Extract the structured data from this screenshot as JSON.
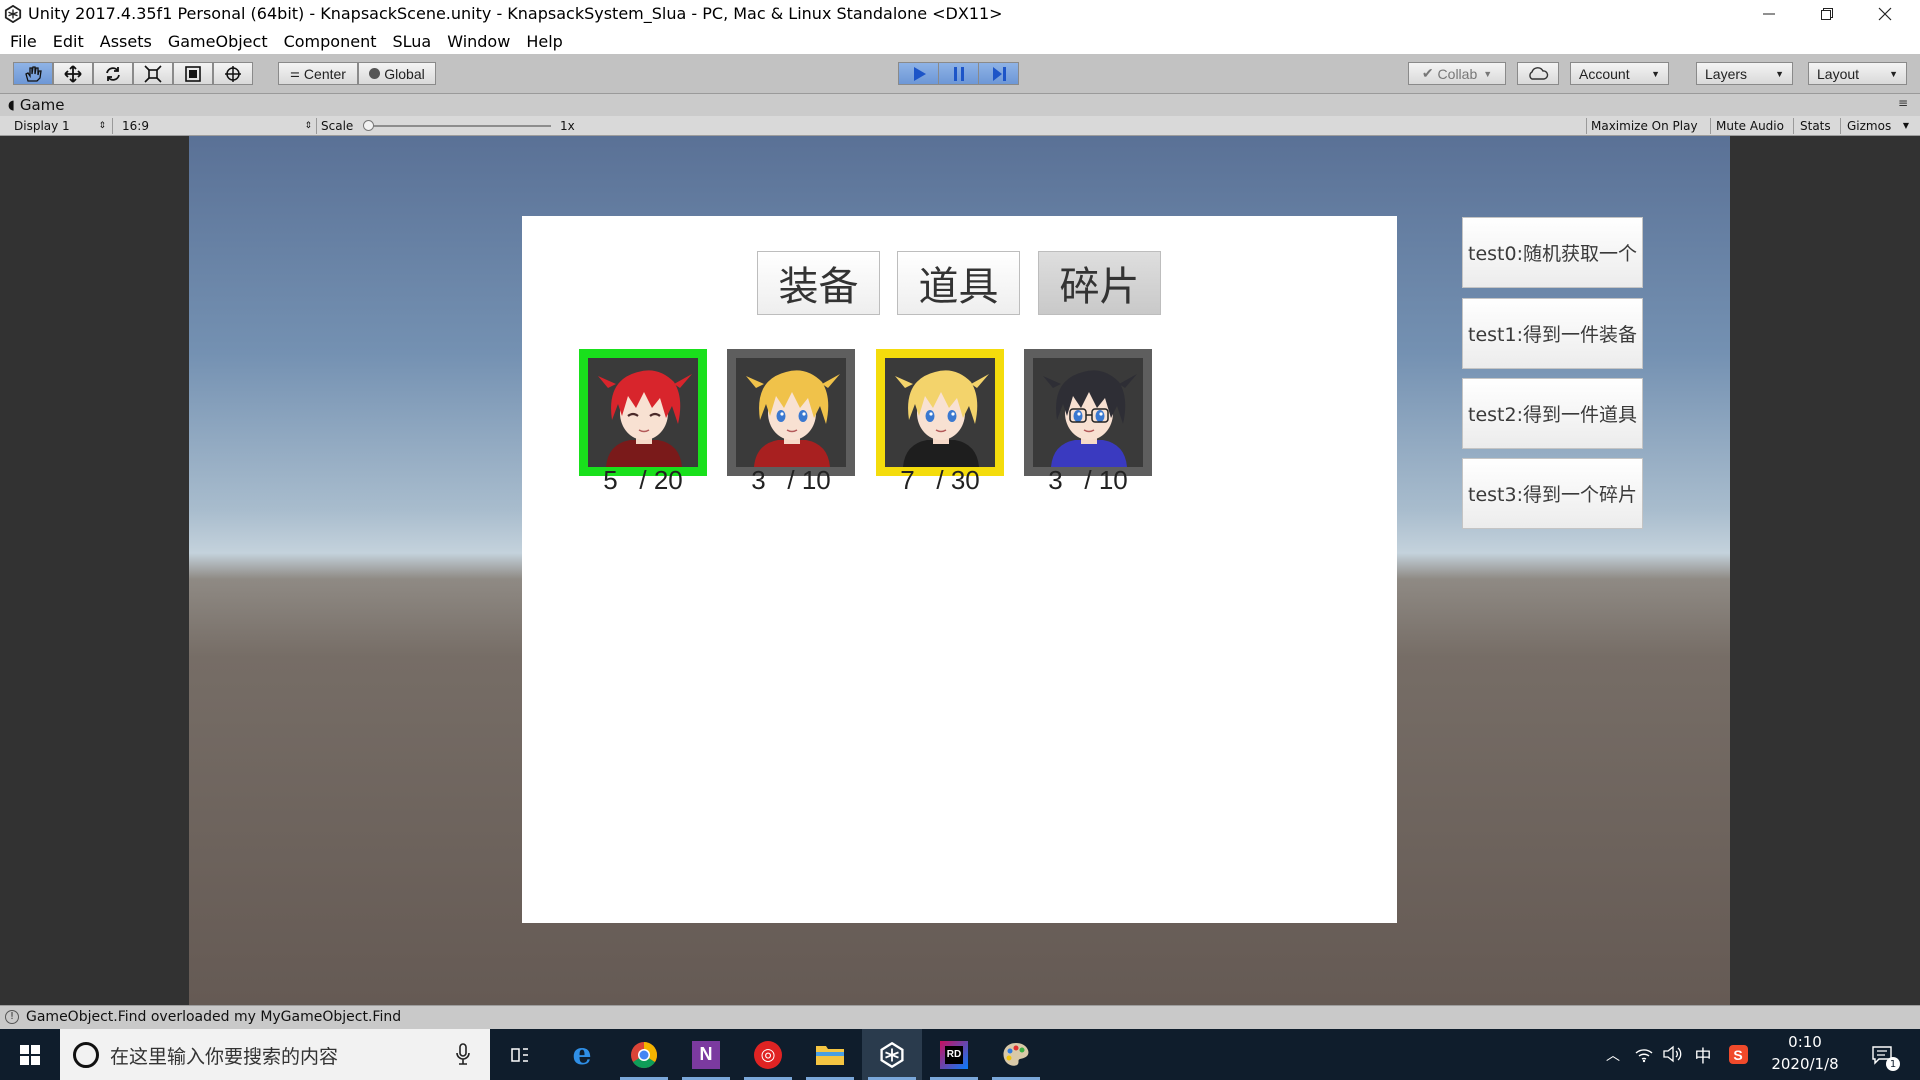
{
  "window": {
    "title": "Unity 2017.4.35f1 Personal (64bit) - KnapsackScene.unity - KnapsackSystem_Slua - PC, Mac & Linux Standalone <DX11>",
    "controls": {
      "minimize": "—",
      "restore": "❐",
      "close": "✕"
    }
  },
  "menu": [
    "File",
    "Edit",
    "Assets",
    "GameObject",
    "Component",
    "SLua",
    "Window",
    "Help"
  ],
  "toolbar": {
    "pivot_label": "Center",
    "space_label": "Global",
    "collab_label": "Collab",
    "account_label": "Account",
    "layers_label": "Layers",
    "layout_label": "Layout"
  },
  "game_view": {
    "tab_label": "Game",
    "display": "Display 1",
    "aspect": "16:9",
    "scale_label": "Scale",
    "scale_value": "1x",
    "maximize_on_play": "Maximize On Play",
    "mute_audio": "Mute Audio",
    "stats": "Stats",
    "gizmos": "Gizmos"
  },
  "knapsack": {
    "tabs": [
      {
        "label": "装备",
        "selected": false
      },
      {
        "label": "道具",
        "selected": false
      },
      {
        "label": "碎片",
        "selected": true
      }
    ],
    "items": [
      {
        "count": "5   / 20",
        "frame_color": "#19e01c",
        "hair": "#d8252c",
        "outfit": "#7a1a1a",
        "expression": "closed-eyes"
      },
      {
        "count": "3   / 10",
        "frame_color": "#5e5e5e",
        "hair": "#f0c24a",
        "outfit": "#a82020",
        "expression": "open"
      },
      {
        "count": "7   / 30",
        "frame_color": "#f4dc0c",
        "hair": "#f3d36b",
        "outfit": "#1e1e1e",
        "expression": "open"
      },
      {
        "count": "3   / 10",
        "frame_color": "#5e5e5e",
        "hair": "#2e2e35",
        "outfit": "#3a3ac0",
        "expression": "glasses"
      }
    ]
  },
  "test_buttons": [
    "test0:随机获取一个",
    "test1:得到一件装备",
    "test2:得到一件道具",
    "test3:得到一个碎片"
  ],
  "status": {
    "message": "GameObject.Find overloaded my MyGameObject.Find"
  },
  "taskbar": {
    "search_placeholder": "在这里输入你要搜索的内容",
    "apps": [
      "task-view",
      "edge",
      "chrome",
      "onenote",
      "netease-music",
      "file-explorer",
      "unity",
      "rider",
      "paint"
    ],
    "ime": "中",
    "time": "0:10",
    "date": "2020/1/8",
    "notification_count": "1"
  }
}
